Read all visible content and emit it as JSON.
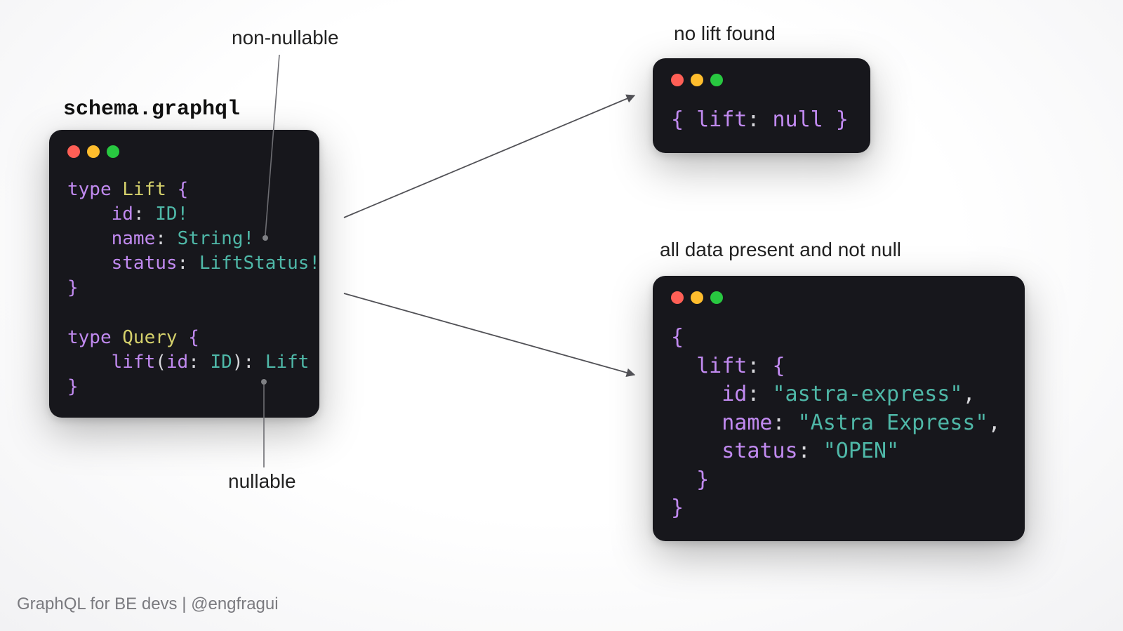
{
  "labels": {
    "file": "schema.graphql",
    "nonnull": "non-nullable",
    "nullable": "nullable",
    "nolift": "no lift found",
    "alldata": "all data present and not null"
  },
  "schema": {
    "l1a": "type",
    "l1b": "Lift",
    "l1c": "{",
    "l2a": "id",
    "l2b": "ID!",
    "l3a": "name",
    "l3b": "String!",
    "l4a": "status",
    "l4b": "LiftStatus!",
    "l5": "}",
    "l7a": "type",
    "l7b": "Query",
    "l7c": "{",
    "l8a": "lift",
    "l8b": "id",
    "l8c": "ID",
    "l8d": "Lift",
    "l9": "}"
  },
  "resp1": {
    "open": "{ ",
    "key": "lift",
    "colon": ": ",
    "val": "null",
    "close": " }"
  },
  "resp2": {
    "o1": "{",
    "k_lift": "lift",
    "o2": "{",
    "k_id": "id",
    "v_id": "\"astra-express\"",
    "k_name": "name",
    "v_name": "\"Astra Express\"",
    "k_status": "status",
    "v_status": "\"OPEN\"",
    "c2": "}",
    "c1": "}"
  },
  "footer": "GraphQL for BE devs | @engfragui"
}
